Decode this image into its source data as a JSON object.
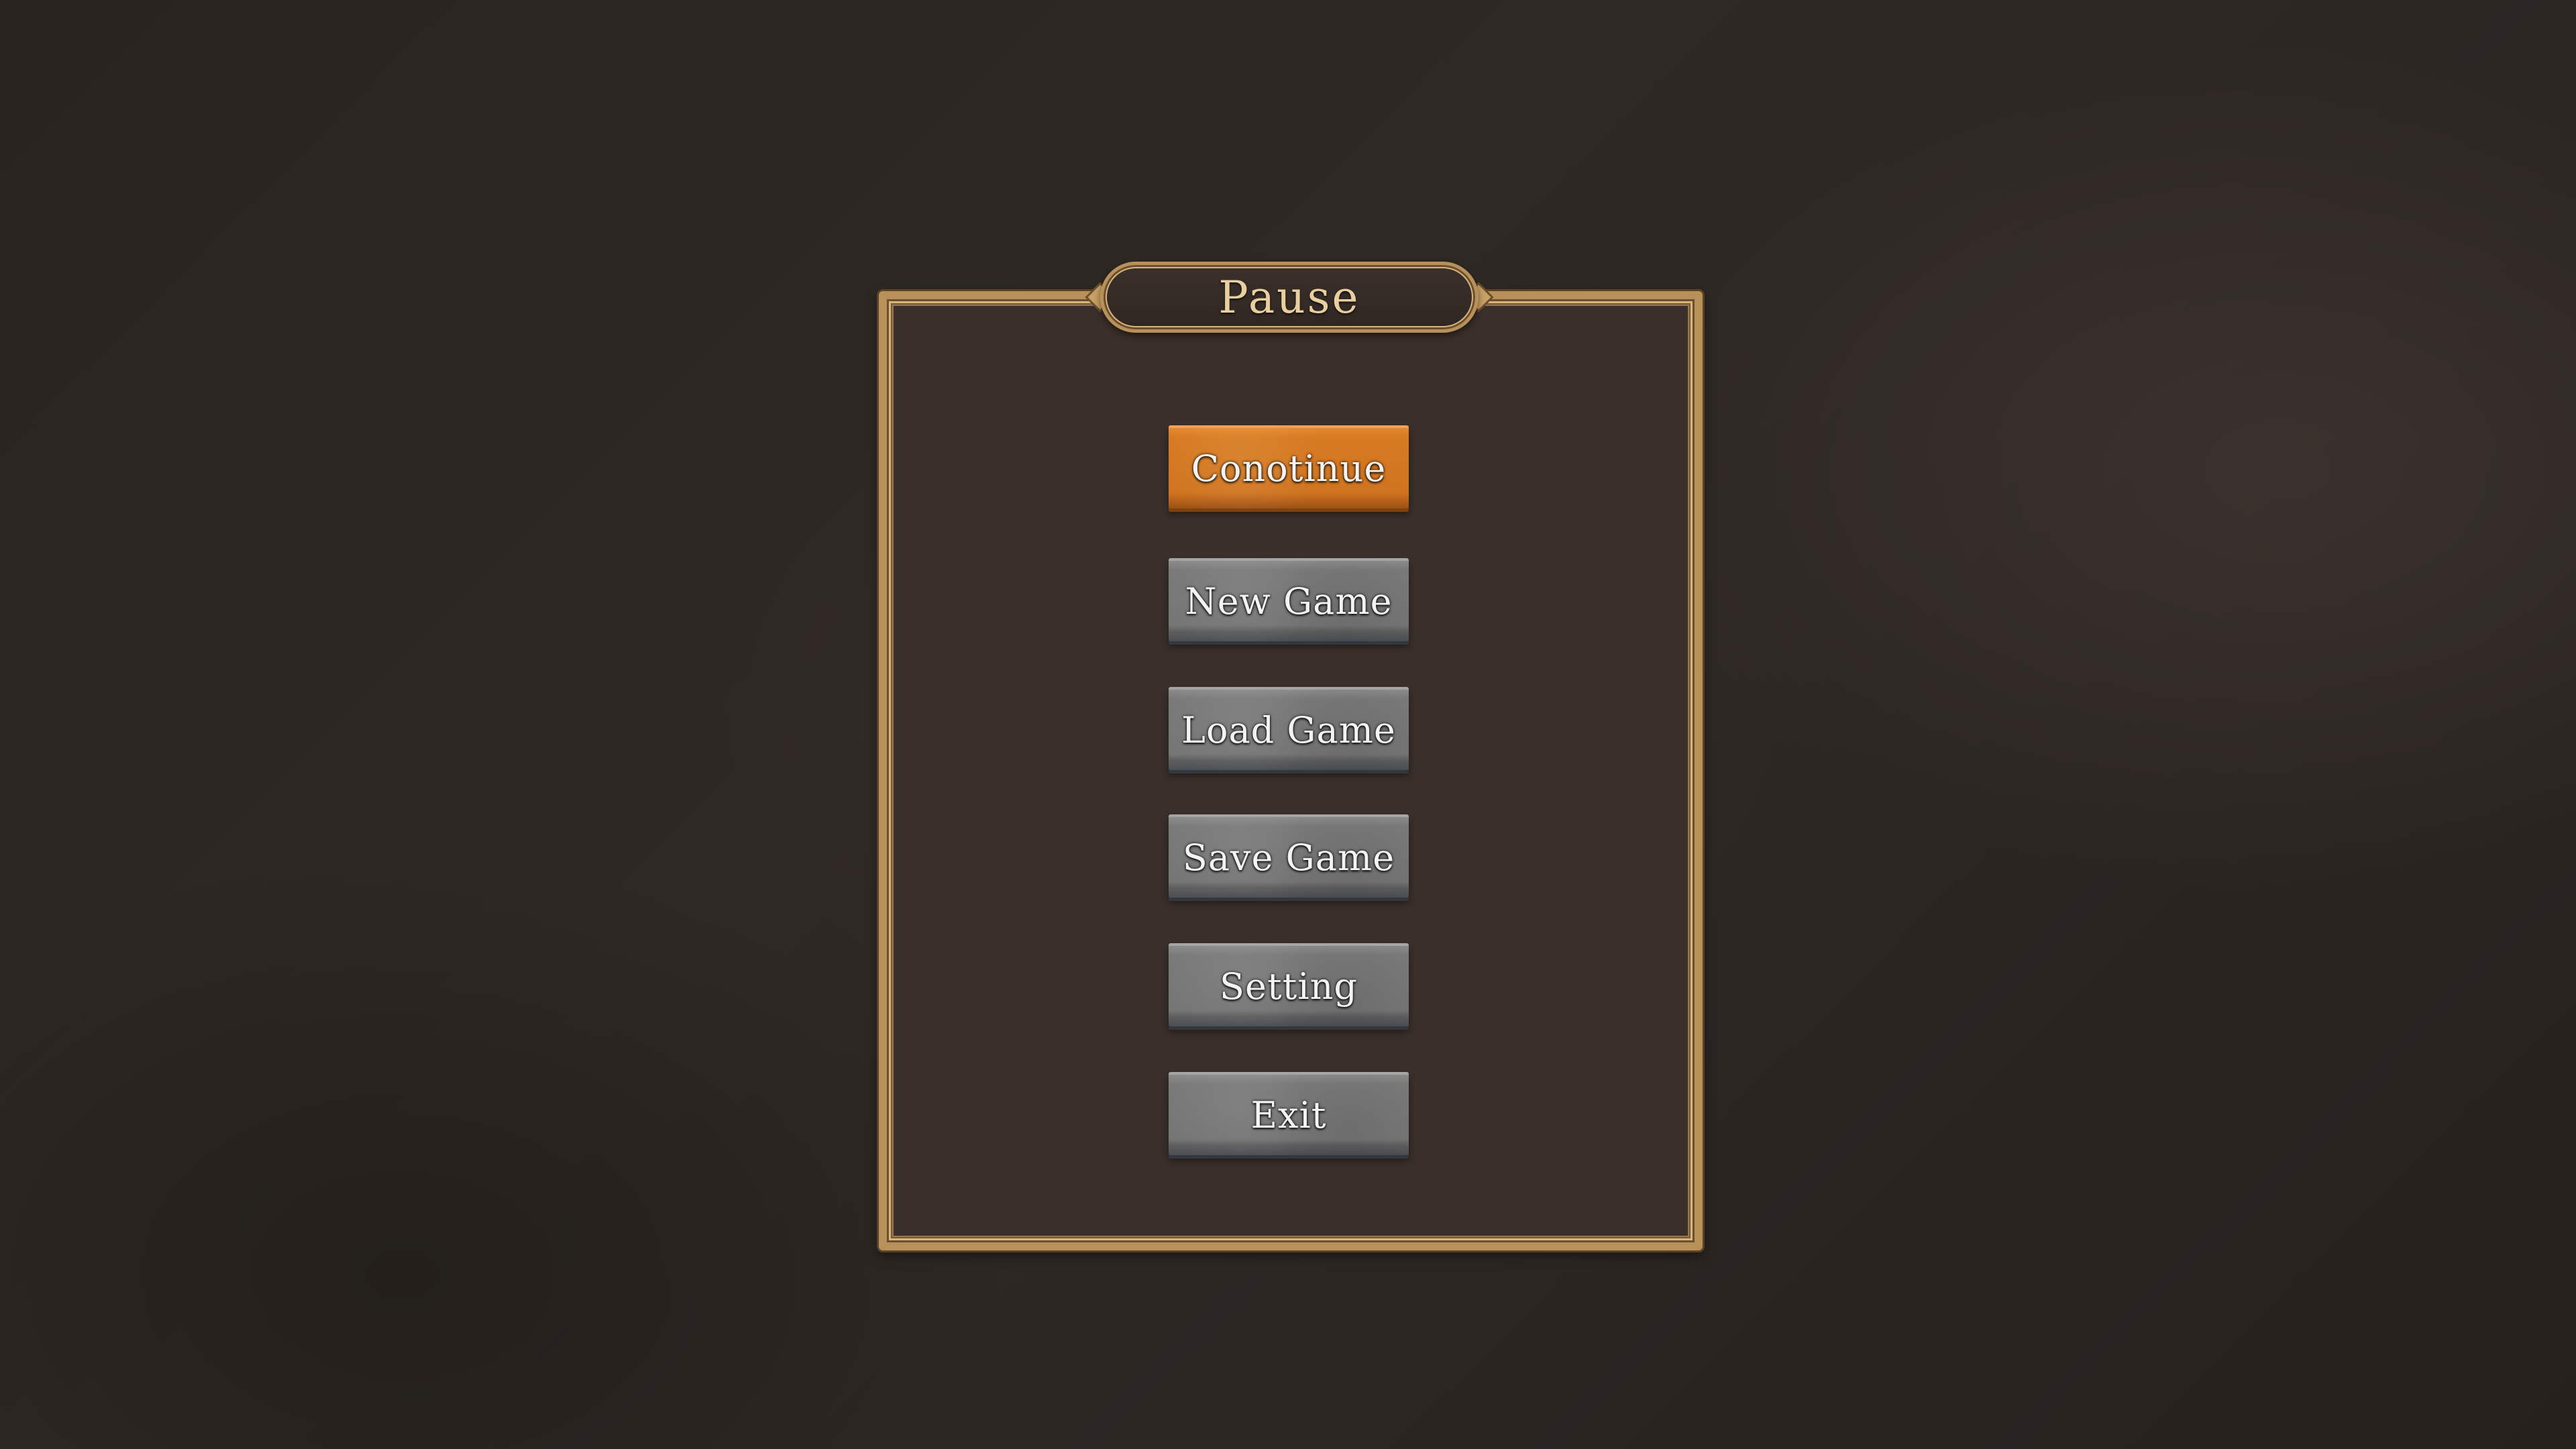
{
  "screen": {
    "title": "Pause"
  },
  "menu": {
    "items": [
      {
        "label": "Conotinue",
        "state": "highlighted"
      },
      {
        "label": "New Game",
        "state": "normal"
      },
      {
        "label": "Load Game",
        "state": "normal"
      },
      {
        "label": "Save Game",
        "state": "normal"
      },
      {
        "label": "Setting",
        "state": "normal"
      },
      {
        "label": "Exit",
        "state": "normal"
      }
    ]
  },
  "colors": {
    "frame_gold": "#b8915a",
    "panel_fill": "#3a2f2a",
    "highlight_orange": "#d77a22",
    "stone_gray": "#7a7a7a",
    "title_text": "#e9cfa0"
  }
}
